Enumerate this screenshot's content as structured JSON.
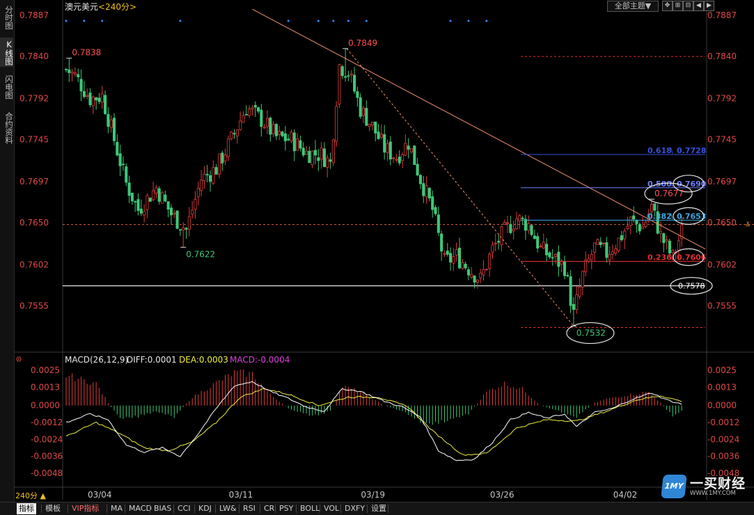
{
  "sidebar": {
    "tabs": [
      {
        "label": "分时图",
        "active": false
      },
      {
        "label": "K线图",
        "active": true
      },
      {
        "label": "闪电图",
        "active": false
      },
      {
        "label": "合约资料",
        "active": false
      }
    ]
  },
  "header": {
    "symbol": "澳元美元",
    "period_tag": "<240分>",
    "theme_button": "全部主题▼",
    "icon_buttons": [
      "move-icon",
      "zoom-in-icon",
      "zoom-out-icon",
      "prev-icon",
      "next-icon"
    ]
  },
  "colors": {
    "up": "#e03c3c",
    "down": "#3cc878",
    "axis_text": "#e04848",
    "trendline": "#f09070",
    "fib_618": "#3850e0",
    "fib_500": "#7080ff",
    "fib_382": "#40a8e0",
    "fib_236": "#e03030",
    "diff_line": "#ffffff",
    "dea_line": "#f0f040",
    "macd_label": "#e040e0"
  },
  "chart_data": [
    {
      "type": "candlestick",
      "name": "main",
      "title": "澳元美元<240分>",
      "ylim": [
        0.7507,
        0.7887
      ],
      "y_ticks": [
        "0.7887",
        "0.7840",
        "0.7792",
        "0.7745",
        "0.7697",
        "0.7650",
        "0.7602",
        "0.7555"
      ],
      "x_ticks": [
        "03/04",
        "03/11",
        "03/19",
        "03/26",
        "04/02"
      ],
      "x_tick_bars": [
        3,
        50,
        94,
        137,
        178
      ],
      "bar_count": 206,
      "anchors": [
        {
          "i": 0,
          "v": 0.7825
        },
        {
          "i": 3,
          "v": 0.7818
        },
        {
          "i": 8,
          "v": 0.7792
        },
        {
          "i": 12,
          "v": 0.7795
        },
        {
          "i": 16,
          "v": 0.7745
        },
        {
          "i": 20,
          "v": 0.7695
        },
        {
          "i": 24,
          "v": 0.7665
        },
        {
          "i": 30,
          "v": 0.769
        },
        {
          "i": 35,
          "v": 0.766
        },
        {
          "i": 40,
          "v": 0.7642
        },
        {
          "i": 45,
          "v": 0.77
        },
        {
          "i": 50,
          "v": 0.7712
        },
        {
          "i": 55,
          "v": 0.7745
        },
        {
          "i": 60,
          "v": 0.7782
        },
        {
          "i": 65,
          "v": 0.7768
        },
        {
          "i": 70,
          "v": 0.7748
        },
        {
          "i": 75,
          "v": 0.7745
        },
        {
          "i": 80,
          "v": 0.773
        },
        {
          "i": 85,
          "v": 0.7728
        },
        {
          "i": 88,
          "v": 0.7718
        },
        {
          "i": 91,
          "v": 0.783
        },
        {
          "i": 94,
          "v": 0.7822
        },
        {
          "i": 98,
          "v": 0.778
        },
        {
          "i": 102,
          "v": 0.776
        },
        {
          "i": 106,
          "v": 0.7735
        },
        {
          "i": 110,
          "v": 0.7725
        },
        {
          "i": 114,
          "v": 0.7742
        },
        {
          "i": 118,
          "v": 0.77
        },
        {
          "i": 122,
          "v": 0.7665
        },
        {
          "i": 126,
          "v": 0.7605
        },
        {
          "i": 130,
          "v": 0.7612
        },
        {
          "i": 134,
          "v": 0.7598
        },
        {
          "i": 138,
          "v": 0.7585
        },
        {
          "i": 142,
          "v": 0.762
        },
        {
          "i": 146,
          "v": 0.764
        },
        {
          "i": 150,
          "v": 0.7655
        },
        {
          "i": 154,
          "v": 0.7648
        },
        {
          "i": 158,
          "v": 0.762
        },
        {
          "i": 162,
          "v": 0.761
        },
        {
          "i": 166,
          "v": 0.76
        },
        {
          "i": 169,
          "v": 0.7545
        },
        {
          "i": 172,
          "v": 0.759
        },
        {
          "i": 176,
          "v": 0.7622
        },
        {
          "i": 180,
          "v": 0.7615
        },
        {
          "i": 184,
          "v": 0.763
        },
        {
          "i": 188,
          "v": 0.7652
        },
        {
          "i": 192,
          "v": 0.7645
        },
        {
          "i": 195,
          "v": 0.7668
        },
        {
          "i": 198,
          "v": 0.7635
        },
        {
          "i": 202,
          "v": 0.761
        },
        {
          "i": 205,
          "v": 0.764
        }
      ],
      "extremes": [
        {
          "label": "0.7838",
          "i": 1,
          "v": 0.7838,
          "kind": "high"
        },
        {
          "label": "0.7622",
          "i": 39,
          "v": 0.7622,
          "kind": "low"
        },
        {
          "label": "0.7849",
          "i": 93,
          "v": 0.7849,
          "kind": "high"
        },
        {
          "label": "0.7532",
          "i": 169,
          "v": 0.7532,
          "kind": "low",
          "circled": true
        },
        {
          "label": "0.7677",
          "i": 195,
          "v": 0.7677,
          "kind": "high",
          "circled": true
        }
      ],
      "current_price": 0.7648,
      "support_line": {
        "value": 0.7578,
        "label": "0.7578"
      },
      "trendline": [
        {
          "i": 62,
          "v": 0.7894
        },
        {
          "i": 230,
          "v": 0.762
        }
      ],
      "dashed_trend": {
        "from": {
          "i": 93,
          "v": 0.7849
        },
        "to": {
          "i": 169,
          "v": 0.7532
        }
      },
      "fib_levels": [
        {
          "ratio": "0.618",
          "value": "0.7728",
          "v": 0.7728,
          "circled": false
        },
        {
          "ratio": "0.500",
          "value": "0.7690",
          "v": 0.769,
          "circled": true
        },
        {
          "ratio": "0.382",
          "value": "0.7653",
          "v": 0.7653,
          "circled": true
        },
        {
          "ratio": "0.236",
          "value": "0.7606",
          "v": 0.7606,
          "circled": true
        }
      ],
      "fib_top": 0.7849,
      "fib_bottom": 0.7532
    },
    {
      "type": "macd",
      "name": "macd",
      "title": "MACD(26,12,9)",
      "diff_label": "DIFF:0.0001",
      "dea_label": "DEA:0.0003",
      "macd_label": "MACD:-0.0004",
      "ylim": [
        -0.0053,
        0.003
      ],
      "y_ticks": [
        "0.0025",
        "0.0013",
        "0.0000",
        "-0.0012",
        "-0.0024",
        "-0.0036",
        "-0.0048"
      ],
      "diff": [
        {
          "i": 0,
          "v": -0.0012
        },
        {
          "i": 8,
          "v": -0.0006
        },
        {
          "i": 14,
          "v": -0.001
        },
        {
          "i": 20,
          "v": -0.0028
        },
        {
          "i": 26,
          "v": -0.0033
        },
        {
          "i": 32,
          "v": -0.003
        },
        {
          "i": 38,
          "v": -0.0036
        },
        {
          "i": 44,
          "v": -0.002
        },
        {
          "i": 50,
          "v": -0.0002
        },
        {
          "i": 56,
          "v": 0.0014
        },
        {
          "i": 62,
          "v": 0.0017
        },
        {
          "i": 68,
          "v": 0.001
        },
        {
          "i": 74,
          "v": 0.0005
        },
        {
          "i": 80,
          "v": -0.0001
        },
        {
          "i": 86,
          "v": -0.0004
        },
        {
          "i": 92,
          "v": 0.0012
        },
        {
          "i": 98,
          "v": 0.001
        },
        {
          "i": 106,
          "v": 0.0003
        },
        {
          "i": 112,
          "v": -0.0001
        },
        {
          "i": 118,
          "v": -0.0008
        },
        {
          "i": 124,
          "v": -0.0032
        },
        {
          "i": 130,
          "v": -0.0039
        },
        {
          "i": 136,
          "v": -0.0038
        },
        {
          "i": 142,
          "v": -0.0026
        },
        {
          "i": 148,
          "v": -0.001
        },
        {
          "i": 154,
          "v": -0.0005
        },
        {
          "i": 160,
          "v": -0.0009
        },
        {
          "i": 166,
          "v": -0.0006
        },
        {
          "i": 170,
          "v": -0.0015
        },
        {
          "i": 176,
          "v": -0.0005
        },
        {
          "i": 182,
          "v": -0.0002
        },
        {
          "i": 188,
          "v": 0.0004
        },
        {
          "i": 195,
          "v": 0.0009
        },
        {
          "i": 200,
          "v": 0.0004
        },
        {
          "i": 205,
          "v": 0.0001
        }
      ],
      "dea": [
        {
          "i": 0,
          "v": -0.0022
        },
        {
          "i": 10,
          "v": -0.0012
        },
        {
          "i": 18,
          "v": -0.002
        },
        {
          "i": 26,
          "v": -0.003
        },
        {
          "i": 34,
          "v": -0.0032
        },
        {
          "i": 42,
          "v": -0.0026
        },
        {
          "i": 50,
          "v": -0.0012
        },
        {
          "i": 58,
          "v": 0.0006
        },
        {
          "i": 66,
          "v": 0.0012
        },
        {
          "i": 74,
          "v": 0.0008
        },
        {
          "i": 84,
          "v": 0.0
        },
        {
          "i": 94,
          "v": 0.0006
        },
        {
          "i": 104,
          "v": 0.0006
        },
        {
          "i": 114,
          "v": -0.0001
        },
        {
          "i": 122,
          "v": -0.0018
        },
        {
          "i": 132,
          "v": -0.0035
        },
        {
          "i": 140,
          "v": -0.0034
        },
        {
          "i": 150,
          "v": -0.0016
        },
        {
          "i": 160,
          "v": -0.001
        },
        {
          "i": 170,
          "v": -0.0011
        },
        {
          "i": 180,
          "v": -0.0004
        },
        {
          "i": 190,
          "v": 0.0004
        },
        {
          "i": 198,
          "v": 0.0007
        },
        {
          "i": 205,
          "v": 0.0003
        }
      ],
      "hist": [
        {
          "i": 0,
          "v": 0.0022
        },
        {
          "i": 10,
          "v": 0.0016
        },
        {
          "i": 14,
          "v": 0.0002
        },
        {
          "i": 18,
          "v": -0.001
        },
        {
          "i": 24,
          "v": -0.0008
        },
        {
          "i": 30,
          "v": -0.0004
        },
        {
          "i": 36,
          "v": -0.0008
        },
        {
          "i": 42,
          "v": 0.0006
        },
        {
          "i": 48,
          "v": 0.0014
        },
        {
          "i": 56,
          "v": 0.0024
        },
        {
          "i": 62,
          "v": 0.0023
        },
        {
          "i": 68,
          "v": 0.0008
        },
        {
          "i": 74,
          "v": -0.0002
        },
        {
          "i": 82,
          "v": -0.0008
        },
        {
          "i": 88,
          "v": -0.0004
        },
        {
          "i": 92,
          "v": 0.0014
        },
        {
          "i": 98,
          "v": 0.001
        },
        {
          "i": 106,
          "v": 0.0
        },
        {
          "i": 112,
          "v": -0.0004
        },
        {
          "i": 120,
          "v": -0.0014
        },
        {
          "i": 128,
          "v": -0.001
        },
        {
          "i": 134,
          "v": -0.0006
        },
        {
          "i": 140,
          "v": 0.001
        },
        {
          "i": 146,
          "v": 0.0016
        },
        {
          "i": 152,
          "v": 0.0012
        },
        {
          "i": 158,
          "v": 0.0
        },
        {
          "i": 164,
          "v": -0.0004
        },
        {
          "i": 170,
          "v": -0.0008
        },
        {
          "i": 176,
          "v": 0.0002
        },
        {
          "i": 182,
          "v": 0.0006
        },
        {
          "i": 188,
          "v": 0.0008
        },
        {
          "i": 194,
          "v": 0.001
        },
        {
          "i": 198,
          "v": 0.0002
        },
        {
          "i": 202,
          "v": -0.0008
        },
        {
          "i": 205,
          "v": -0.0004
        }
      ]
    }
  ],
  "footer": {
    "period_label": "240分 ▲",
    "tabs": [
      "指标",
      "模板",
      "VIP指标",
      "MA",
      "MACD",
      "BIAS",
      "CCI",
      "KDJ",
      "LW&",
      "RSI",
      "CR",
      "PSY",
      "BOLL",
      "VOL",
      "DXFY",
      "设置"
    ]
  },
  "logo": {
    "badge": "1MY",
    "name": "一买财经",
    "url": "WWW.1MY.COM"
  }
}
